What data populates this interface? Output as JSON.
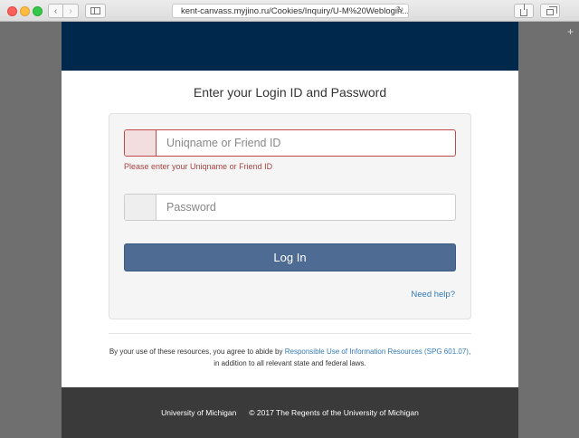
{
  "browser": {
    "url": "kent-canvass.myjino.ru/Cookies/Inquiry/U-M%20Weblogin...",
    "back_glyph": "‹",
    "forward_glyph": "›",
    "reload_glyph": "↻",
    "new_tab_glyph": "+"
  },
  "colors": {
    "header": "#00274c",
    "button": "#4d6b93",
    "error": "#a94442",
    "link": "#337ab7",
    "footer": "#3a3a3a"
  },
  "page": {
    "title": "Enter your Login ID and Password"
  },
  "form": {
    "username_placeholder": "Uniqname or Friend ID",
    "username_value": "",
    "username_error": "Please enter your Uniqname or Friend ID",
    "password_placeholder": "Password",
    "password_value": "",
    "login_label": "Log In",
    "help_label": "Need help?"
  },
  "terms": {
    "prefix": "By your use of these resources, you agree to abide by ",
    "link": "Responsible Use of Information Resources (SPG 601.07)",
    "suffix": ", in addition to all relevant state and federal laws."
  },
  "footer": {
    "university": "University of Michigan",
    "copyright": "© 2017 The Regents of the University of Michigan"
  }
}
